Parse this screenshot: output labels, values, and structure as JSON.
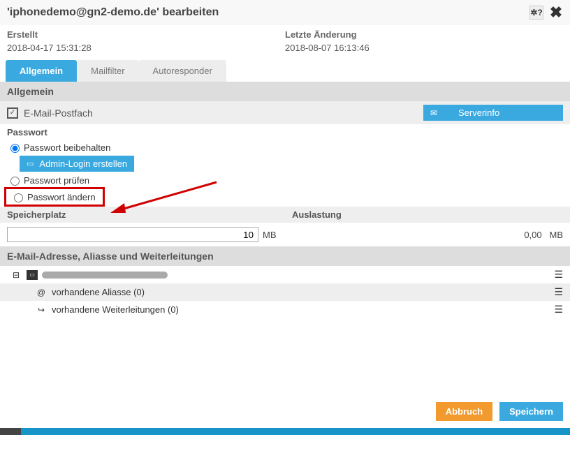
{
  "header": {
    "title": "'iphonedemo@gn2-demo.de' bearbeiten"
  },
  "meta": {
    "created_label": "Erstellt",
    "created_value": "2018-04-17 15:31:28",
    "modified_label": "Letzte Änderung",
    "modified_value": "2018-08-07 16:13:46"
  },
  "tabs": {
    "general": "Allgemein",
    "mailfilter": "Mailfilter",
    "autoresponder": "Autoresponder"
  },
  "section_general": "Allgemein",
  "mailbox_label": "E-Mail-Postfach",
  "serverinfo_label": "Serverinfo",
  "passwort_heading": "Passwort",
  "pw_keep": "Passwort beibehalten",
  "admin_login_btn": "Admin-Login erstellen",
  "pw_check": "Passwort prüfen",
  "pw_change": "Passwort ändern",
  "storage": {
    "heading": "Speicherplatz",
    "usage_heading": "Auslastung",
    "value": "10",
    "unit": "MB",
    "usage_value": "0,00",
    "usage_unit": "MB"
  },
  "aliases_heading": "E-Mail-Adresse, Aliasse und Weiterleitungen",
  "aliases_row": "vorhandene Aliasse (0)",
  "forward_row": "vorhandene Weiterleitungen (0)",
  "footer": {
    "cancel": "Abbruch",
    "save": "Speichern"
  }
}
